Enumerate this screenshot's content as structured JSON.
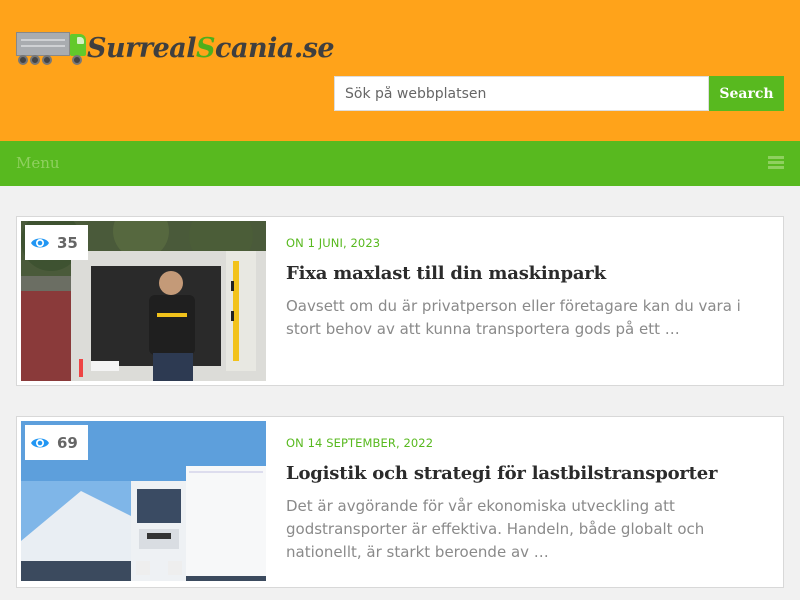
{
  "site": {
    "logo_prefix": "Surreal",
    "logo_s": "S",
    "logo_suffix": "cania.se",
    "icon": "truck-icon"
  },
  "search": {
    "placeholder": "Sök på webbplatsen",
    "button_label": "Search"
  },
  "nav": {
    "menu_label": "Menu",
    "icon": "hamburger-icon"
  },
  "colors": {
    "header_bg": "#ffa31a",
    "accent_green": "#58b91f",
    "page_bg": "#f1f1f1"
  },
  "posts": [
    {
      "views": "35",
      "date": "ON 1 JUNI, 2023",
      "title": "Fixa maxlast till din maskinpark",
      "excerpt": "Oavsett om du är privatperson eller företagare kan du vara i stort behov av att kunna transportera gods på ett …",
      "image": "van-loading-photo"
    },
    {
      "views": "69",
      "date": "ON 14 SEPTEMBER, 2022",
      "title": "Logistik och strategi för lastbilstransporter",
      "excerpt": "Det är avgörande för vår ekonomiska utveckling att godstransporter är effektiva. Handeln, både globalt och nationellt, är starkt beroende av …",
      "image": "white-truck-photo"
    }
  ]
}
